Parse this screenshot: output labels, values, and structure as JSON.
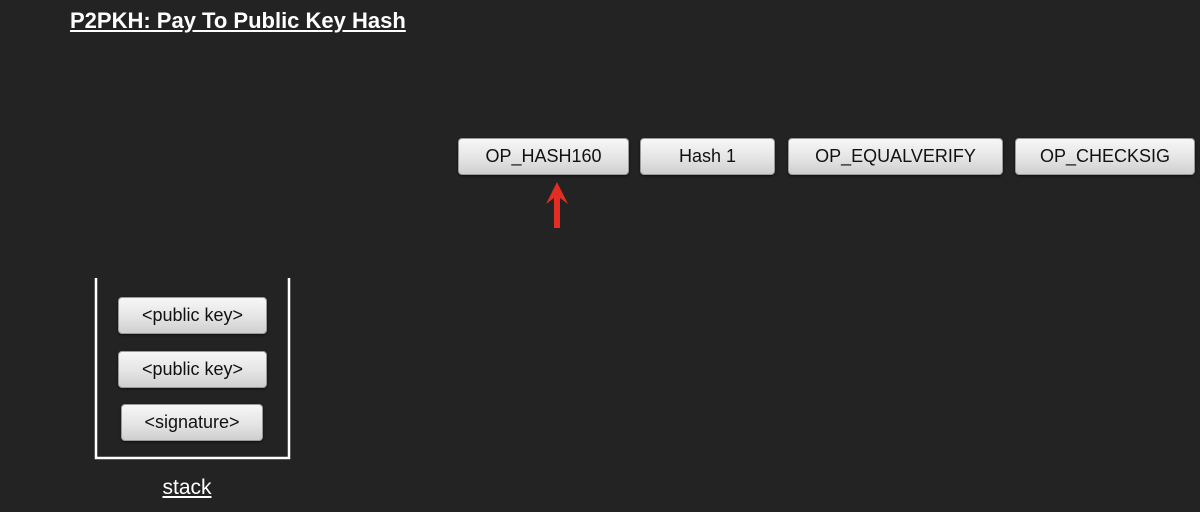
{
  "title": "P2PKH: Pay To Public Key Hash",
  "script_ops": [
    "OP_HASH160",
    "Hash 1",
    "OP_EQUALVERIFY",
    "OP_CHECKSIG"
  ],
  "current_op_index": 0,
  "stack": {
    "label": "stack",
    "items": [
      "<public key>",
      "<public key>",
      "<signature>"
    ]
  },
  "colors": {
    "background": "#232323",
    "pointer": "#e32d22",
    "text": "#ffffff"
  }
}
